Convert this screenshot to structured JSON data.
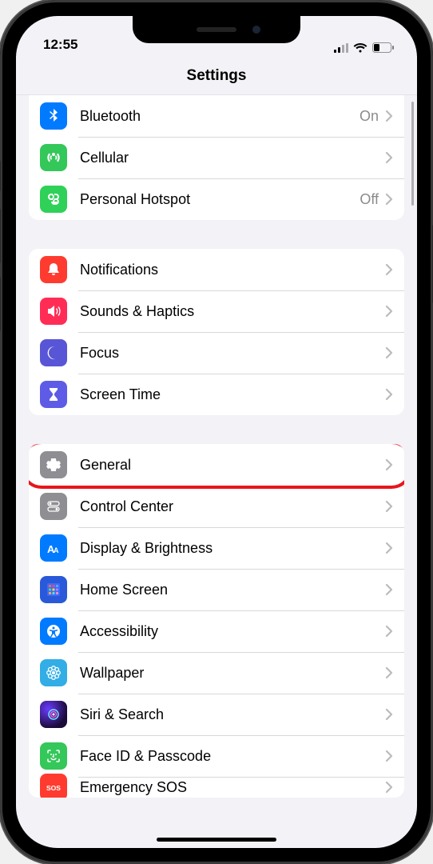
{
  "status": {
    "time": "12:55"
  },
  "header": {
    "title": "Settings"
  },
  "groups": [
    {
      "rows": [
        {
          "id": "bluetooth",
          "label": "Bluetooth",
          "detail": "On",
          "icon": "bluetooth-icon",
          "bg": "bg-blue"
        },
        {
          "id": "cellular",
          "label": "Cellular",
          "detail": "",
          "icon": "antenna-icon",
          "bg": "bg-green"
        },
        {
          "id": "hotspot",
          "label": "Personal Hotspot",
          "detail": "Off",
          "icon": "link-icon",
          "bg": "bg-green2"
        }
      ]
    },
    {
      "rows": [
        {
          "id": "notifications",
          "label": "Notifications",
          "detail": "",
          "icon": "bell-icon",
          "bg": "bg-red"
        },
        {
          "id": "sounds",
          "label": "Sounds & Haptics",
          "detail": "",
          "icon": "speaker-icon",
          "bg": "bg-pink"
        },
        {
          "id": "focus",
          "label": "Focus",
          "detail": "",
          "icon": "moon-icon",
          "bg": "bg-indigo"
        },
        {
          "id": "screentime",
          "label": "Screen Time",
          "detail": "",
          "icon": "hourglass-icon",
          "bg": "bg-purple"
        }
      ]
    },
    {
      "rows": [
        {
          "id": "general",
          "label": "General",
          "detail": "",
          "icon": "gear-icon",
          "bg": "bg-gray",
          "highlight": true
        },
        {
          "id": "controlcenter",
          "label": "Control Center",
          "detail": "",
          "icon": "switches-icon",
          "bg": "bg-gray"
        },
        {
          "id": "display",
          "label": "Display & Brightness",
          "detail": "",
          "icon": "textsize-icon",
          "bg": "bg-blue"
        },
        {
          "id": "homescreen",
          "label": "Home Screen",
          "detail": "",
          "icon": "grid-icon",
          "bg": "bg-homescreen"
        },
        {
          "id": "accessibility",
          "label": "Accessibility",
          "detail": "",
          "icon": "accessibility-icon",
          "bg": "bg-blue"
        },
        {
          "id": "wallpaper",
          "label": "Wallpaper",
          "detail": "",
          "icon": "flower-icon",
          "bg": "bg-cyan"
        },
        {
          "id": "siri",
          "label": "Siri & Search",
          "detail": "",
          "icon": "siri-icon",
          "bg": "bg-siri"
        },
        {
          "id": "faceid",
          "label": "Face ID & Passcode",
          "detail": "",
          "icon": "faceid-icon",
          "bg": "bg-green"
        },
        {
          "id": "sos",
          "label": "Emergency SOS",
          "detail": "",
          "icon": "sos-icon",
          "bg": "bg-red",
          "cut": true
        }
      ]
    }
  ]
}
